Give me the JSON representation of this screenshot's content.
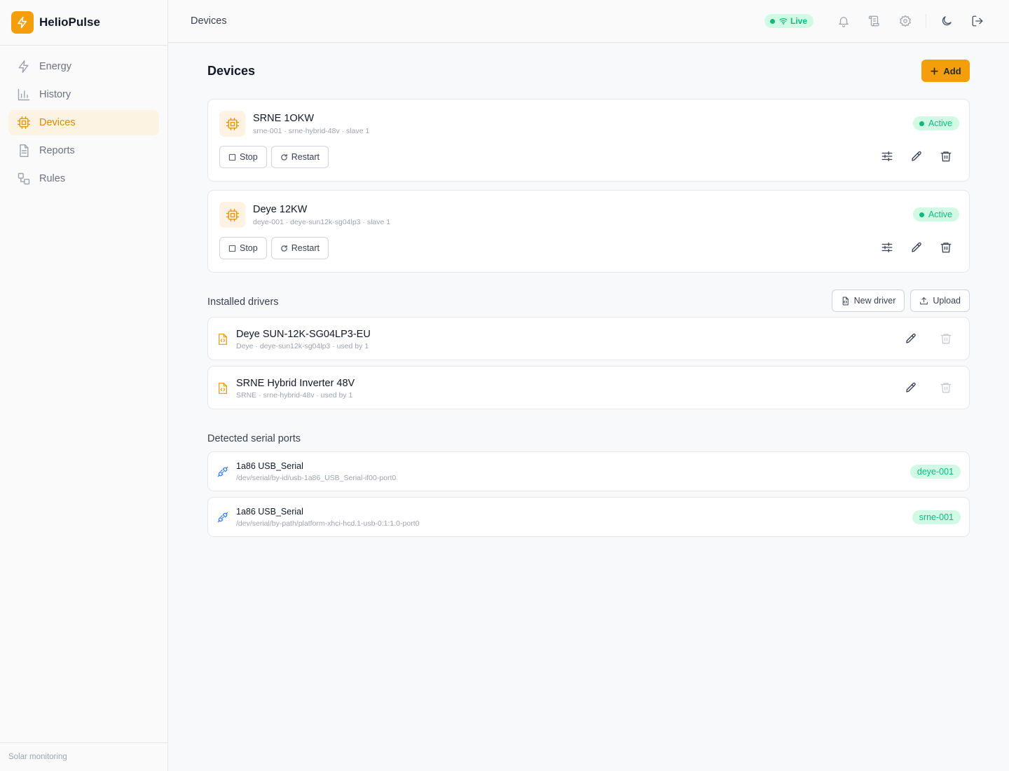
{
  "app": {
    "name": "HelioPulse",
    "footer": "Solar monitoring"
  },
  "sidebar": {
    "items": [
      {
        "label": "Energy",
        "icon": "bolt-icon",
        "active": false
      },
      {
        "label": "History",
        "icon": "bar-chart-icon",
        "active": false
      },
      {
        "label": "Devices",
        "icon": "chip-icon",
        "active": true
      },
      {
        "label": "Reports",
        "icon": "document-icon",
        "active": false
      },
      {
        "label": "Rules",
        "icon": "flow-icon",
        "active": false
      }
    ]
  },
  "header": {
    "title": "Devices",
    "live_label": "Live",
    "icons": [
      "bell-icon",
      "scroll-icon",
      "gear-icon",
      "moon-icon",
      "logout-icon"
    ]
  },
  "page": {
    "title": "Devices",
    "add_label": "Add"
  },
  "devices": [
    {
      "name": "SRNE 1OKW",
      "meta": "srne-001 · srne-hybrid-48v · slave 1",
      "status": "Active",
      "stop_label": "Stop",
      "restart_label": "Restart"
    },
    {
      "name": "Deye 12KW",
      "meta": "deye-001 · deye-sun12k-sg04lp3 · slave 1",
      "status": "Active",
      "stop_label": "Stop",
      "restart_label": "Restart"
    }
  ],
  "drivers_section": {
    "title": "Installed drivers",
    "new_driver_label": "New driver",
    "upload_label": "Upload",
    "items": [
      {
        "name": "Deye SUN-12K-SG04LP3-EU",
        "meta": "Deye · deye-sun12k-sg04lp3 · used by 1"
      },
      {
        "name": "SRNE Hybrid Inverter 48V",
        "meta": "SRNE · srne-hybrid-48v · used by 1"
      }
    ]
  },
  "ports_section": {
    "title": "Detected serial ports",
    "items": [
      {
        "name": "1a86 USB_Serial",
        "path": "/dev/serial/by-id/usb-1a86_USB_Serial-if00-port0",
        "tag": "deye-001"
      },
      {
        "name": "1a86 USB_Serial",
        "path": "/dev/serial/by-path/platform-xhci-hcd.1-usb-0:1:1.0-port0",
        "tag": "srne-001"
      }
    ]
  },
  "colors": {
    "accent": "#f59e0b",
    "success": "#10b981",
    "success_bg": "#d1fae5",
    "port_icon": "#3b82f6"
  }
}
